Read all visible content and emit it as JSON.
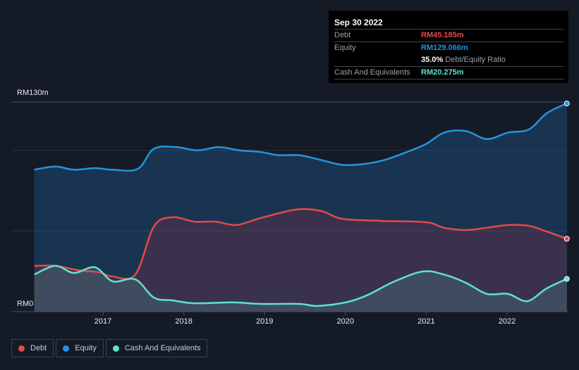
{
  "tooltip": {
    "date": "Sep 30 2022",
    "debt_label": "Debt",
    "debt_value": "RM45.185m",
    "equity_label": "Equity",
    "equity_value": "RM129.066m",
    "ratio_value": "35.0%",
    "ratio_label": "Debt/Equity Ratio",
    "cash_label": "Cash And Equivalents",
    "cash_value": "RM20.275m"
  },
  "legend": [
    {
      "label": "Debt",
      "color": "#e5484d"
    },
    {
      "label": "Equity",
      "color": "#2394e0"
    },
    {
      "label": "Cash And Equivalents",
      "color": "#5ee3cf"
    }
  ],
  "chart_data": {
    "type": "area",
    "ylabel_top": "RM130m",
    "ylabel_bottom": "RM0",
    "ylim": [
      0,
      130
    ],
    "xlim": [
      2016.15,
      2022.74
    ],
    "x_ticks": [
      "2017",
      "2018",
      "2019",
      "2020",
      "2021",
      "2022"
    ],
    "grid": [
      50,
      100,
      130
    ],
    "series": [
      {
        "name": "Equity",
        "color": "#2394e0",
        "x": [
          2016.15,
          2016.41,
          2016.64,
          2016.9,
          2017.12,
          2017.43,
          2017.63,
          2017.91,
          2018.17,
          2018.43,
          2018.69,
          2018.95,
          2019.17,
          2019.43,
          2019.7,
          2019.96,
          2020.22,
          2020.48,
          2020.74,
          2021.0,
          2021.22,
          2021.49,
          2021.75,
          2022.01,
          2022.27,
          2022.49,
          2022.74
        ],
        "values": [
          88,
          90,
          88,
          89,
          88,
          88.5,
          101,
          102,
          100,
          102,
          100,
          99,
          97,
          97,
          94,
          91,
          91.5,
          94,
          98.6,
          104,
          111,
          112,
          107,
          111,
          113,
          123,
          129.1
        ]
      },
      {
        "name": "Debt",
        "color": "#e5484d",
        "x": [
          2016.15,
          2016.41,
          2016.69,
          2016.95,
          2017.12,
          2017.4,
          2017.63,
          2017.86,
          2018.13,
          2018.39,
          2018.65,
          2018.95,
          2019.39,
          2019.7,
          2019.96,
          2020.44,
          2021.0,
          2021.22,
          2021.49,
          2021.75,
          2022.01,
          2022.27,
          2022.49,
          2022.74
        ],
        "values": [
          28.4,
          28.4,
          25.7,
          24.4,
          21.8,
          23,
          52.8,
          58.5,
          55.8,
          55.8,
          53.7,
          58,
          63.3,
          62.4,
          57.6,
          56.3,
          55.4,
          52,
          50.6,
          52,
          53.7,
          53.2,
          49.7,
          45.2
        ]
      },
      {
        "name": "Cash And Equivalents",
        "color": "#5ee3cf",
        "x": [
          2016.15,
          2016.41,
          2016.64,
          2016.9,
          2017.12,
          2017.4,
          2017.63,
          2017.86,
          2018.13,
          2018.61,
          2018.95,
          2019.43,
          2019.65,
          2020.0,
          2020.26,
          2020.61,
          2020.96,
          2021.22,
          2021.49,
          2021.75,
          2022.01,
          2022.25,
          2022.49,
          2022.74
        ],
        "values": [
          23,
          28.4,
          24,
          27.5,
          18.8,
          20,
          8.7,
          7,
          5.2,
          5.7,
          4.8,
          4.8,
          3.5,
          5.7,
          10,
          18.8,
          24.9,
          23,
          17.9,
          11,
          11,
          6.5,
          14.4,
          20.3
        ]
      }
    ]
  }
}
